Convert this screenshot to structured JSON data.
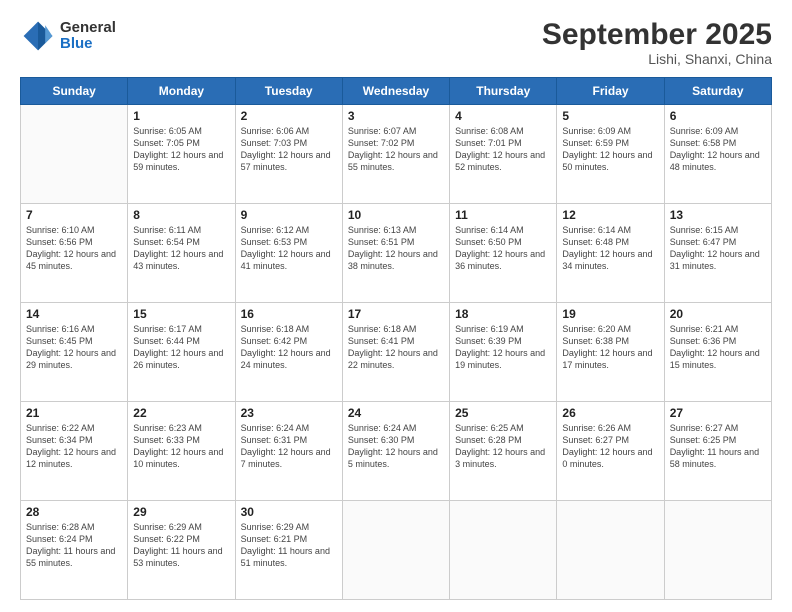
{
  "logo": {
    "general": "General",
    "blue": "Blue"
  },
  "header": {
    "month": "September 2025",
    "location": "Lishi, Shanxi, China"
  },
  "weekdays": [
    "Sunday",
    "Monday",
    "Tuesday",
    "Wednesday",
    "Thursday",
    "Friday",
    "Saturday"
  ],
  "weeks": [
    [
      {
        "day": "",
        "sunrise": "",
        "sunset": "",
        "daylight": ""
      },
      {
        "day": "1",
        "sunrise": "Sunrise: 6:05 AM",
        "sunset": "Sunset: 7:05 PM",
        "daylight": "Daylight: 12 hours and 59 minutes."
      },
      {
        "day": "2",
        "sunrise": "Sunrise: 6:06 AM",
        "sunset": "Sunset: 7:03 PM",
        "daylight": "Daylight: 12 hours and 57 minutes."
      },
      {
        "day": "3",
        "sunrise": "Sunrise: 6:07 AM",
        "sunset": "Sunset: 7:02 PM",
        "daylight": "Daylight: 12 hours and 55 minutes."
      },
      {
        "day": "4",
        "sunrise": "Sunrise: 6:08 AM",
        "sunset": "Sunset: 7:01 PM",
        "daylight": "Daylight: 12 hours and 52 minutes."
      },
      {
        "day": "5",
        "sunrise": "Sunrise: 6:09 AM",
        "sunset": "Sunset: 6:59 PM",
        "daylight": "Daylight: 12 hours and 50 minutes."
      },
      {
        "day": "6",
        "sunrise": "Sunrise: 6:09 AM",
        "sunset": "Sunset: 6:58 PM",
        "daylight": "Daylight: 12 hours and 48 minutes."
      }
    ],
    [
      {
        "day": "7",
        "sunrise": "Sunrise: 6:10 AM",
        "sunset": "Sunset: 6:56 PM",
        "daylight": "Daylight: 12 hours and 45 minutes."
      },
      {
        "day": "8",
        "sunrise": "Sunrise: 6:11 AM",
        "sunset": "Sunset: 6:54 PM",
        "daylight": "Daylight: 12 hours and 43 minutes."
      },
      {
        "day": "9",
        "sunrise": "Sunrise: 6:12 AM",
        "sunset": "Sunset: 6:53 PM",
        "daylight": "Daylight: 12 hours and 41 minutes."
      },
      {
        "day": "10",
        "sunrise": "Sunrise: 6:13 AM",
        "sunset": "Sunset: 6:51 PM",
        "daylight": "Daylight: 12 hours and 38 minutes."
      },
      {
        "day": "11",
        "sunrise": "Sunrise: 6:14 AM",
        "sunset": "Sunset: 6:50 PM",
        "daylight": "Daylight: 12 hours and 36 minutes."
      },
      {
        "day": "12",
        "sunrise": "Sunrise: 6:14 AM",
        "sunset": "Sunset: 6:48 PM",
        "daylight": "Daylight: 12 hours and 34 minutes."
      },
      {
        "day": "13",
        "sunrise": "Sunrise: 6:15 AM",
        "sunset": "Sunset: 6:47 PM",
        "daylight": "Daylight: 12 hours and 31 minutes."
      }
    ],
    [
      {
        "day": "14",
        "sunrise": "Sunrise: 6:16 AM",
        "sunset": "Sunset: 6:45 PM",
        "daylight": "Daylight: 12 hours and 29 minutes."
      },
      {
        "day": "15",
        "sunrise": "Sunrise: 6:17 AM",
        "sunset": "Sunset: 6:44 PM",
        "daylight": "Daylight: 12 hours and 26 minutes."
      },
      {
        "day": "16",
        "sunrise": "Sunrise: 6:18 AM",
        "sunset": "Sunset: 6:42 PM",
        "daylight": "Daylight: 12 hours and 24 minutes."
      },
      {
        "day": "17",
        "sunrise": "Sunrise: 6:18 AM",
        "sunset": "Sunset: 6:41 PM",
        "daylight": "Daylight: 12 hours and 22 minutes."
      },
      {
        "day": "18",
        "sunrise": "Sunrise: 6:19 AM",
        "sunset": "Sunset: 6:39 PM",
        "daylight": "Daylight: 12 hours and 19 minutes."
      },
      {
        "day": "19",
        "sunrise": "Sunrise: 6:20 AM",
        "sunset": "Sunset: 6:38 PM",
        "daylight": "Daylight: 12 hours and 17 minutes."
      },
      {
        "day": "20",
        "sunrise": "Sunrise: 6:21 AM",
        "sunset": "Sunset: 6:36 PM",
        "daylight": "Daylight: 12 hours and 15 minutes."
      }
    ],
    [
      {
        "day": "21",
        "sunrise": "Sunrise: 6:22 AM",
        "sunset": "Sunset: 6:34 PM",
        "daylight": "Daylight: 12 hours and 12 minutes."
      },
      {
        "day": "22",
        "sunrise": "Sunrise: 6:23 AM",
        "sunset": "Sunset: 6:33 PM",
        "daylight": "Daylight: 12 hours and 10 minutes."
      },
      {
        "day": "23",
        "sunrise": "Sunrise: 6:24 AM",
        "sunset": "Sunset: 6:31 PM",
        "daylight": "Daylight: 12 hours and 7 minutes."
      },
      {
        "day": "24",
        "sunrise": "Sunrise: 6:24 AM",
        "sunset": "Sunset: 6:30 PM",
        "daylight": "Daylight: 12 hours and 5 minutes."
      },
      {
        "day": "25",
        "sunrise": "Sunrise: 6:25 AM",
        "sunset": "Sunset: 6:28 PM",
        "daylight": "Daylight: 12 hours and 3 minutes."
      },
      {
        "day": "26",
        "sunrise": "Sunrise: 6:26 AM",
        "sunset": "Sunset: 6:27 PM",
        "daylight": "Daylight: 12 hours and 0 minutes."
      },
      {
        "day": "27",
        "sunrise": "Sunrise: 6:27 AM",
        "sunset": "Sunset: 6:25 PM",
        "daylight": "Daylight: 11 hours and 58 minutes."
      }
    ],
    [
      {
        "day": "28",
        "sunrise": "Sunrise: 6:28 AM",
        "sunset": "Sunset: 6:24 PM",
        "daylight": "Daylight: 11 hours and 55 minutes."
      },
      {
        "day": "29",
        "sunrise": "Sunrise: 6:29 AM",
        "sunset": "Sunset: 6:22 PM",
        "daylight": "Daylight: 11 hours and 53 minutes."
      },
      {
        "day": "30",
        "sunrise": "Sunrise: 6:29 AM",
        "sunset": "Sunset: 6:21 PM",
        "daylight": "Daylight: 11 hours and 51 minutes."
      },
      {
        "day": "",
        "sunrise": "",
        "sunset": "",
        "daylight": ""
      },
      {
        "day": "",
        "sunrise": "",
        "sunset": "",
        "daylight": ""
      },
      {
        "day": "",
        "sunrise": "",
        "sunset": "",
        "daylight": ""
      },
      {
        "day": "",
        "sunrise": "",
        "sunset": "",
        "daylight": ""
      }
    ]
  ]
}
